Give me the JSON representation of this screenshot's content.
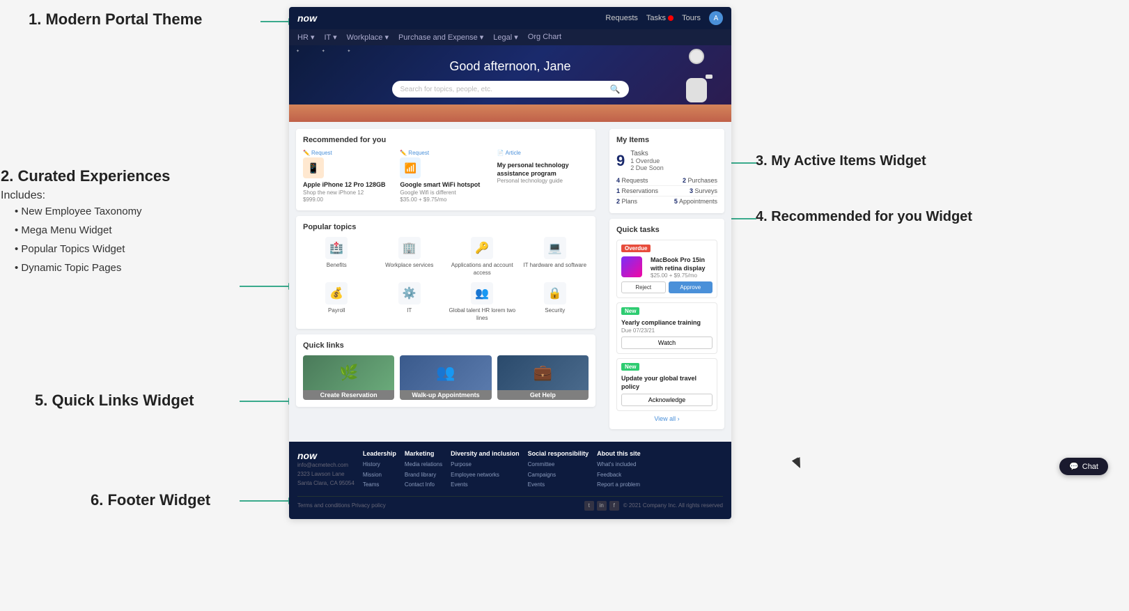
{
  "labels": {
    "label1": "1. Modern Portal Theme",
    "label2": "2. Curated Experiences",
    "label2_includes": "Includes:",
    "label2_bullets": [
      "New Employee Taxonomy",
      "Mega Menu Widget",
      "Popular Topics Widget",
      "Dynamic Topic Pages"
    ],
    "label3": "3. My Active Items Widget",
    "label4": "4. Recommended for you Widget",
    "label5": "5. Quick Links Widget",
    "label6": "6. Footer Widget"
  },
  "portal": {
    "logo": "now",
    "topnav": {
      "items": [
        "Requests",
        "Tasks",
        "Tours"
      ],
      "avatar_label": "A"
    },
    "secnav": {
      "items": [
        "HR ▾",
        "IT ▾",
        "Workplace ▾",
        "Purchase and Expense ▾",
        "Legal ▾",
        "Org Chart"
      ]
    },
    "hero": {
      "greeting": "Good afternoon, Jane",
      "search_placeholder": "Search for topics, people, etc."
    },
    "recommended": {
      "title": "Recommended for you",
      "items": [
        {
          "tag": "Request",
          "title": "Apple iPhone 12 Pro 128GB",
          "sub": "Shop the new iPhone 12",
          "price": "$999.00"
        },
        {
          "tag": "Request",
          "title": "Google smart WiFi hotspot",
          "sub": "Google Wifi is different",
          "price": "$35.00 + $9.75/mo"
        },
        {
          "tag": "Article",
          "title": "My personal technology assistance program",
          "sub": "Personal technology guide"
        }
      ]
    },
    "popular_topics": {
      "title": "Popular topics",
      "items": [
        {
          "name": "Benefits",
          "icon": "🏥"
        },
        {
          "name": "Workplace services",
          "icon": "🏢"
        },
        {
          "name": "Applications and account access",
          "icon": "🔑"
        },
        {
          "name": "IT hardware and software",
          "icon": "💻"
        },
        {
          "name": "Payroll",
          "icon": "💰"
        },
        {
          "name": "IT",
          "icon": "⚙️"
        },
        {
          "name": "Global talent HR lorem two lines",
          "icon": "👥"
        },
        {
          "name": "Security",
          "icon": "🔒"
        }
      ]
    },
    "quick_links": {
      "title": "Quick links",
      "items": [
        {
          "label": "Create Reservation",
          "color": "#4a7c59",
          "bg": "#6aaa7a"
        },
        {
          "label": "Walk-up Appointments",
          "color": "#3a5a8c",
          "bg": "#5a7aac"
        },
        {
          "label": "Get Help",
          "color": "#2a4a6c",
          "bg": "#4a6a8c"
        }
      ]
    },
    "my_items": {
      "title": "My Items",
      "big_num": "9",
      "big_label": "Tasks",
      "overdue": "1 Overdue",
      "due_soon": "2 Due Soon",
      "rows": [
        {
          "left_num": "4",
          "left_label": "Requests",
          "right_num": "2",
          "right_label": "Purchases"
        },
        {
          "left_num": "1",
          "left_label": "Reservations",
          "right_num": "3",
          "right_label": "Surveys"
        },
        {
          "left_num": "2",
          "left_label": "Plans",
          "right_num": "5",
          "right_label": "Appointments"
        }
      ]
    },
    "quick_tasks": {
      "title": "Quick tasks",
      "items": [
        {
          "badge": "Overdue",
          "badge_type": "overdue",
          "title": "MacBook Pro 15in with retina display",
          "sub": "$25.00 + $9.75/mo",
          "buttons": [
            "Reject",
            "Approve"
          ]
        },
        {
          "badge": "New",
          "badge_type": "new",
          "title": "Yearly compliance training",
          "sub": "Due 07/23/21",
          "buttons": [
            "Watch"
          ]
        },
        {
          "badge": "New",
          "badge_type": "new",
          "title": "Update your global travel policy",
          "sub": "",
          "buttons": [
            "Acknowledge"
          ]
        }
      ],
      "view_all": "View all ›"
    },
    "footer": {
      "logo": "now",
      "address_line1": "info@acmetech.com",
      "address_line2": "2323 Lawson Lane",
      "address_line3": "Santa Clara, CA 95054",
      "columns": [
        {
          "title": "Leadership",
          "links": [
            "History",
            "Mission",
            "Teams"
          ]
        },
        {
          "title": "Marketing",
          "links": [
            "Media relations",
            "Brand library",
            "Contact Info"
          ]
        },
        {
          "title": "Diversity and inclusion",
          "links": [
            "Purpose",
            "Employee networks",
            "Events"
          ]
        },
        {
          "title": "Social responsibility",
          "links": [
            "Committee",
            "Campaigns",
            "Events"
          ]
        },
        {
          "title": "About this site",
          "links": [
            "What's included",
            "Feedback",
            "Report a problem"
          ]
        }
      ],
      "bottom_left": "Terms and conditions    Privacy policy",
      "bottom_right": "© 2021 Company Inc. All rights reserved"
    },
    "chat_button": "Chat"
  }
}
